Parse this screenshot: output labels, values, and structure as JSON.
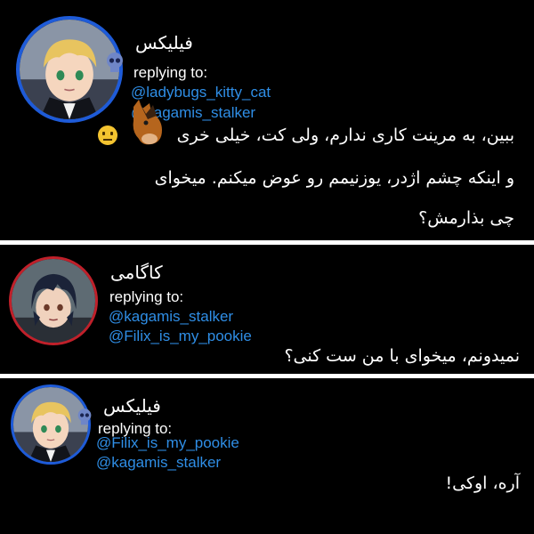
{
  "posts": [
    {
      "username": "فیلیکس",
      "replying_label": "replying to:",
      "mentions": [
        "@ladybugs_kitty_cat",
        "@kagamis_stalker"
      ],
      "lines": [
        "ببین، به مرینت کاری ندارم، ولی کت، خیلی خری",
        "و اینکه چشم اژدر، یوزنیمم رو عوض میکنم. میخوای",
        "چی بذارمش؟"
      ],
      "avatar_ring": "#1e5bd8"
    },
    {
      "username": "کاگامی",
      "replying_label": "replying to:",
      "mentions": [
        "@kagamis_stalker",
        "@Filix_is_my_pookie"
      ],
      "lines": [
        "نمیدونم، میخوای با من ست کنی؟"
      ],
      "avatar_ring": "#c0202a"
    },
    {
      "username": "فیلیکس",
      "replying_label": "replying to:",
      "mentions": [
        "@Filix_is_my_pookie",
        "@kagamis_stalker"
      ],
      "lines": [
        "آره، اوکی!"
      ],
      "avatar_ring": "#1e5bd8"
    }
  ],
  "colors": {
    "background": "#000000",
    "text": "#ffffff",
    "mention": "#2f8ee6",
    "divider": "#ffffff"
  },
  "icons": [
    "neutral-face-emoji-icon",
    "horse-face-emoji-icon",
    "skull-icon"
  ]
}
